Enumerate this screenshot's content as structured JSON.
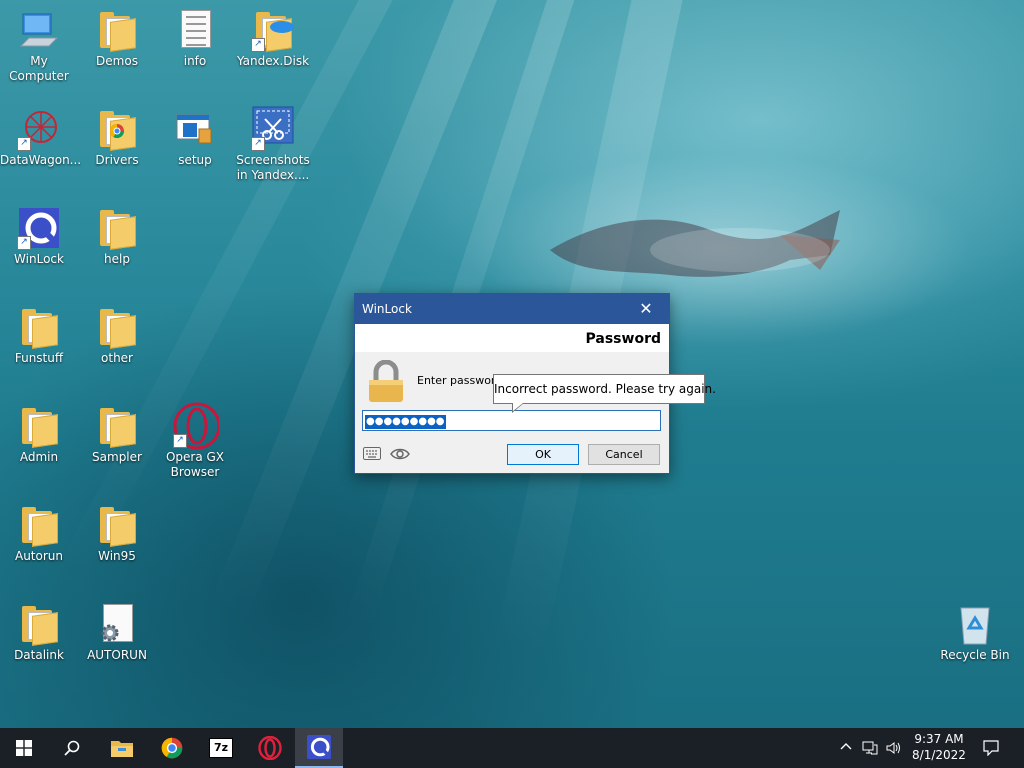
{
  "desktop": {
    "icons": {
      "my_computer": "My Computer",
      "demos": "Demos",
      "info": "info",
      "yandex_disk": "Yandex.Disk",
      "datawagon": "DataWagon...",
      "drivers": "Drivers",
      "setup": "setup",
      "screenshots": "Screenshots in Yandex....",
      "winlock": "WinLock",
      "help": "help",
      "funstuff": "Funstuff",
      "other": "other",
      "admin": "Admin",
      "sampler": "Sampler",
      "opera_gx": "Opera GX Browser",
      "autorun": "Autorun",
      "win95": "Win95",
      "datalink": "Datalink",
      "autorun_file": "AUTORUN",
      "recycle_bin": "Recycle Bin"
    }
  },
  "dialog": {
    "title": "WinLock",
    "close_glyph": "✕",
    "header": "Password",
    "prompt": "Enter password",
    "password_value": "●●●●●●●●●",
    "ok_label": "OK",
    "cancel_label": "Cancel"
  },
  "tooltip": {
    "text": "Incorrect password. Please try again."
  },
  "taskbar": {
    "clock_time": "9:37 AM",
    "clock_date": "8/1/2022",
    "pinned": [
      "start-icon",
      "search-icon",
      "file-explorer-icon",
      "chrome-icon",
      "7zip-icon",
      "opera-icon",
      "winlock-icon"
    ],
    "sevenzip_label": "7z"
  },
  "colors": {
    "dialog_title_bg": "#2b579a",
    "taskbar_bg": "#1b1f26",
    "selection": "#0b62c2"
  }
}
